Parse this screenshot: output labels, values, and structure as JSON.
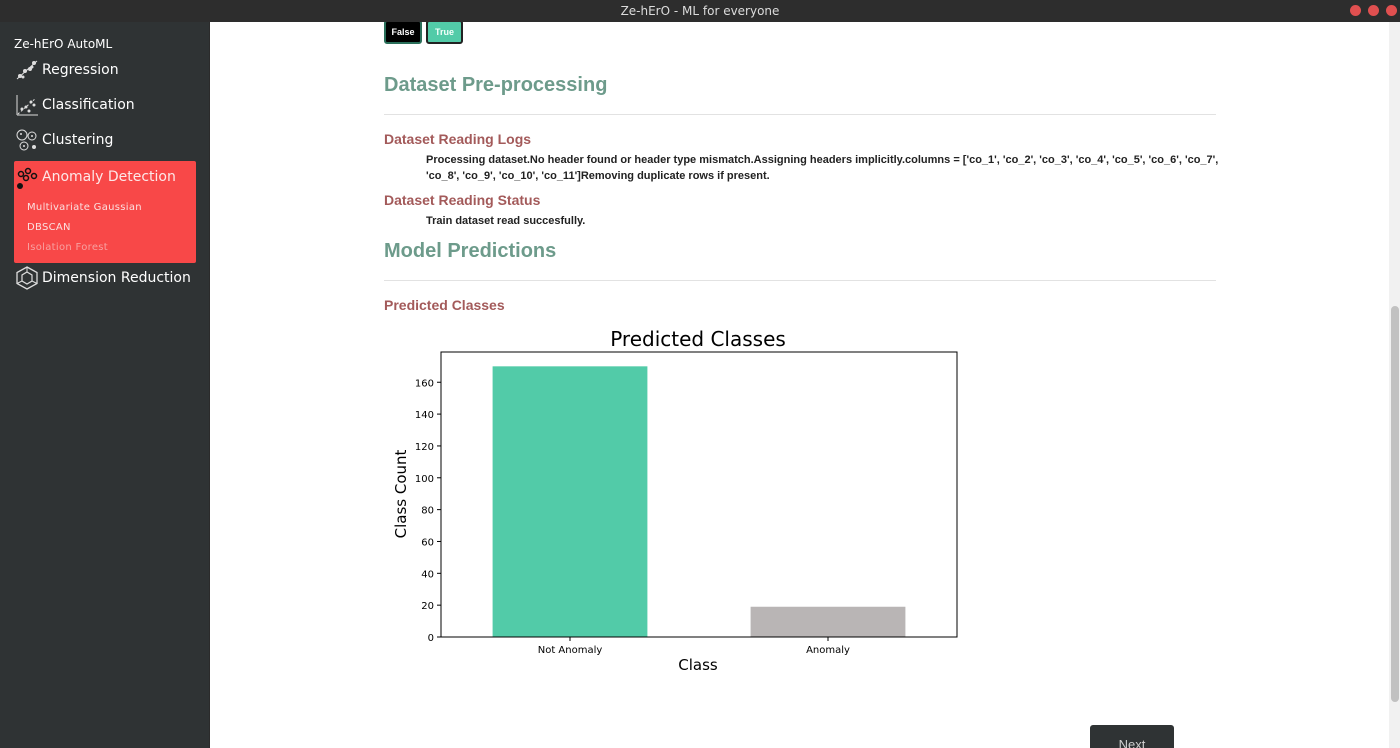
{
  "window": {
    "title": "Ze-hErO - ML for everyone",
    "controls": {
      "minimize_color": "#e05050",
      "maximize_color": "#e05050",
      "close_color": "#e05050"
    }
  },
  "sidebar": {
    "brand": "Ze-hErO AutoML",
    "items": [
      {
        "label": "Regression",
        "icon": "regression-icon"
      },
      {
        "label": "Classification",
        "icon": "classification-icon"
      },
      {
        "label": "Clustering",
        "icon": "clustering-icon"
      },
      {
        "label": "Anomaly Detection",
        "icon": "anomaly-icon",
        "active": true,
        "subitems": [
          "Multivariate Gaussian",
          "DBSCAN",
          "Isolation Forest"
        ]
      },
      {
        "label": "Dimension Reduction",
        "icon": "dimension-reduction-icon"
      }
    ],
    "active_color": "#f84848"
  },
  "toggle": {
    "false_label": "False",
    "true_label": "True",
    "selected": "True",
    "selected_color": "#52cba8"
  },
  "preprocessing": {
    "heading": "Dataset Pre-processing",
    "logs_heading": "Dataset Reading Logs",
    "logs_line1": "Processing dataset.No header found or header type mismatch.Assigning headers implicitly.columns = ['co_1', 'co_2', 'co_3', 'co_4', 'co_5', 'co_6', 'co_7',",
    "logs_line2": "'co_8', 'co_9', 'co_10', 'co_11']Removing duplicate rows if present.",
    "status_heading": "Dataset Reading Status",
    "status_text": "Train dataset read succesfully."
  },
  "predictions": {
    "heading": "Model Predictions",
    "sub_heading": "Predicted Classes"
  },
  "chart_data": {
    "type": "bar",
    "title": "Predicted Classes",
    "xlabel": "Class",
    "ylabel": "Class Count",
    "categories": [
      "Not Anomaly",
      "Anomaly"
    ],
    "values": [
      170,
      19
    ],
    "colors": [
      "#52cba8",
      "#b9b5b5"
    ],
    "ylim": [
      0,
      179
    ],
    "yticks": [
      0,
      20,
      40,
      60,
      80,
      100,
      120,
      140,
      160
    ],
    "grid": false
  },
  "footer": {
    "next_label": "Next"
  }
}
